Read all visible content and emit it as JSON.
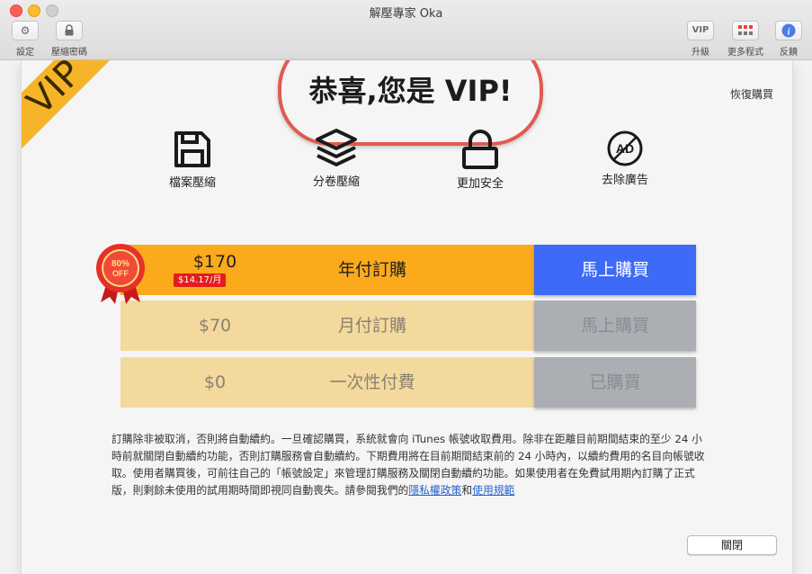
{
  "window": {
    "title": "解壓專家 Oka"
  },
  "toolbar": {
    "settings_label": "設定",
    "password_label": "壓縮密碼",
    "upgrade_label": "升級",
    "upgrade_icon_text": "VIP",
    "more_apps_label": "更多程式",
    "feedback_label": "反饋"
  },
  "dialog": {
    "ribbon_text": "VIP",
    "headline": "恭喜,您是 VIP!",
    "restore_label": "恢復購買",
    "features": [
      {
        "icon": "save-icon",
        "label": "檔案壓縮"
      },
      {
        "icon": "layers-icon",
        "label": "分卷壓縮"
      },
      {
        "icon": "lock-icon",
        "label": "更加安全"
      },
      {
        "icon": "no-ads-icon",
        "label": "去除廣告",
        "icon_text": "AD"
      }
    ],
    "badge": {
      "line1": "80%",
      "line2": "OFF"
    },
    "plans": [
      {
        "price": "$170",
        "per_month": "$14.17/月",
        "name": "年付訂購",
        "action": "馬上購買",
        "state": "active"
      },
      {
        "price": "$70",
        "name": "月付訂購",
        "action": "馬上購買",
        "state": "disabled"
      },
      {
        "price": "$0",
        "name": "一次性付費",
        "action": "已購買",
        "state": "purchased"
      }
    ],
    "terms_text": "訂購除非被取消，否則將自動續約。一旦確認購買，系統就會向 iTunes 帳號收取費用。除非在距離目前期間結束的至少 24 小時前就關閉自動續約功能，否則訂購服務會自動續約。下期費用將在目前期間結束前的 24 小時內，以續約費用的名目向帳號收取。使用者購買後，可前往自己的「帳號設定」來管理訂購服務及關閉自動續約功能。如果使用者在免費試用期內訂購了正式版，則剩餘未使用的試用期時間即視同自動喪失。請參閱我們的",
    "privacy_link": "隱私權政策",
    "and_text": "和",
    "terms_link": "使用規範",
    "close_label": "關閉"
  },
  "colors": {
    "accent_blue": "#3d6af6",
    "plan_orange": "#fbaa1b",
    "ribbon_yellow": "#f6b429",
    "highlight_red": "#e05a50"
  }
}
